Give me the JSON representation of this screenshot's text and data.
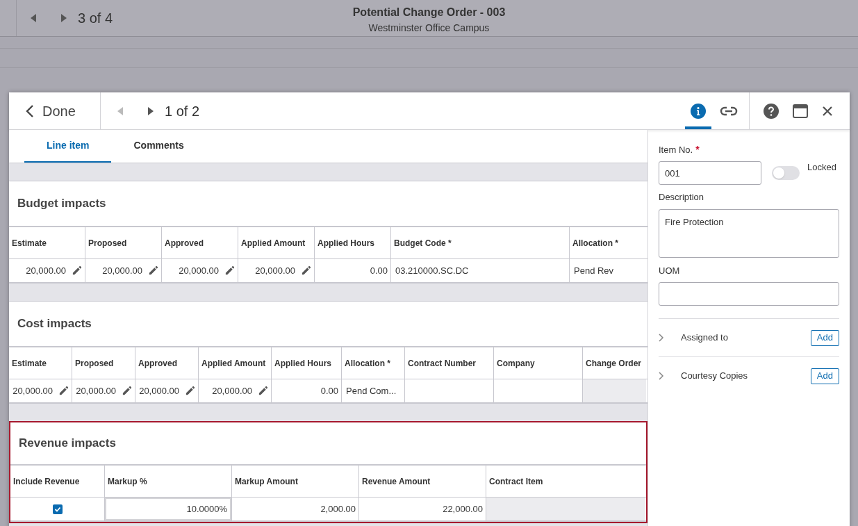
{
  "background": {
    "pager": "3 of 4",
    "title": "Potential Change Order - 003",
    "subtitle": "Westminster Office Campus"
  },
  "modal": {
    "done": "Done",
    "pager": "1 of 2",
    "header_icons": [
      {
        "kind": "info",
        "selected": true
      },
      {
        "kind": "link",
        "selected": false
      }
    ],
    "tabs": [
      {
        "label": "Line item",
        "selected": true
      },
      {
        "label": "Comments",
        "selected": false
      }
    ],
    "sections": [
      {
        "title": "Budget impacts",
        "highlighted": false,
        "columns": [
          "Estimate",
          "Proposed",
          "Approved",
          "Applied Amount",
          "Applied Hours",
          "Budget Code *",
          "Allocation *"
        ],
        "cells": [
          {
            "kind": "number",
            "text": "20,000.00",
            "editable": true
          },
          {
            "kind": "number",
            "text": "20,000.00",
            "editable": true
          },
          {
            "kind": "number",
            "text": "20,000.00",
            "editable": true
          },
          {
            "kind": "number",
            "text": "20,000.00",
            "editable": true
          },
          {
            "kind": "number",
            "text": "0.00",
            "editable": false
          },
          {
            "kind": "text",
            "text": "03.210000.SC.DC",
            "disabled": false
          },
          {
            "kind": "text",
            "text": "Pend Rev",
            "disabled": false
          }
        ]
      },
      {
        "title": "Cost impacts",
        "highlighted": false,
        "columns": [
          "Estimate",
          "Proposed",
          "Approved",
          "Applied Amount",
          "Applied Hours",
          "Allocation *",
          "Contract Number",
          "Company",
          "Change Order"
        ],
        "cells": [
          {
            "kind": "number",
            "text": "20,000.00",
            "editable": true
          },
          {
            "kind": "number",
            "text": "20,000.00",
            "editable": true
          },
          {
            "kind": "number",
            "text": "20,000.00",
            "editable": true
          },
          {
            "kind": "number",
            "text": "20,000.00",
            "editable": true
          },
          {
            "kind": "number",
            "text": "0.00",
            "editable": false
          },
          {
            "kind": "text",
            "text": "Pend Com...",
            "disabled": false
          },
          {
            "kind": "empty",
            "disabled": false
          },
          {
            "kind": "empty",
            "disabled": false
          },
          {
            "kind": "empty",
            "disabled": true
          }
        ]
      },
      {
        "title": "Revenue impacts",
        "highlighted": true,
        "columns": [
          "Include Revenue",
          "Markup %",
          "Markup Amount",
          "Revenue Amount",
          "Contract Item"
        ],
        "cells": [
          {
            "kind": "checkbox",
            "checked": true
          },
          {
            "kind": "input",
            "text": "10.0000%"
          },
          {
            "kind": "number",
            "text": "2,000.00",
            "editable": false
          },
          {
            "kind": "number",
            "text": "22,000.00",
            "editable": false
          },
          {
            "kind": "empty",
            "disabled": true
          }
        ]
      }
    ],
    "details": {
      "item_no": {
        "label": "Item No.",
        "required_mark": "*",
        "value": "001"
      },
      "locked": {
        "label": "Locked",
        "on": false
      },
      "description": {
        "label": "Description",
        "value": "Fire Protection"
      },
      "uom": {
        "label": "UOM"
      },
      "groups": [
        {
          "label": "Assigned to",
          "expanded": false,
          "button": "Add"
        },
        {
          "label": "Courtesy Copies",
          "expanded": false,
          "button": "Add"
        }
      ]
    }
  }
}
